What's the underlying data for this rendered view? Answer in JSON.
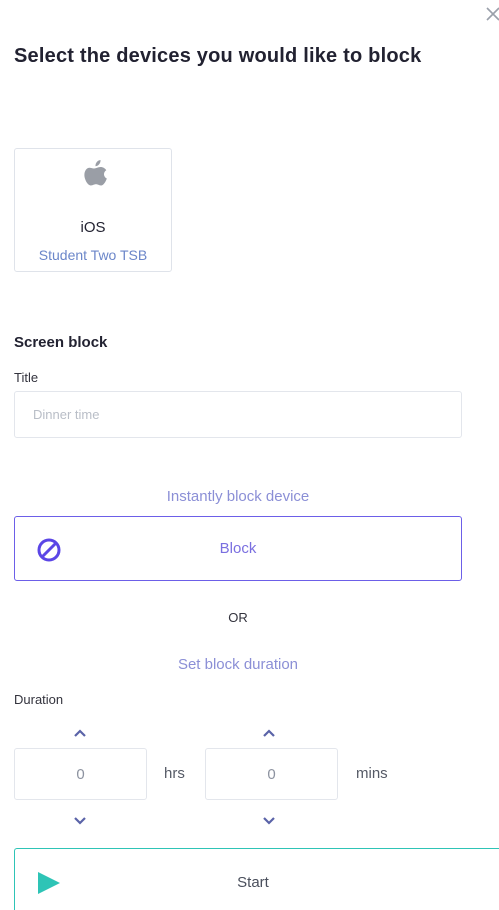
{
  "modal": {
    "close_icon": "close-icon",
    "heading": "Select the devices you would like to block"
  },
  "device": {
    "icon": "apple-icon",
    "name": "iOS",
    "owner": "Student Two TSB"
  },
  "screen_block": {
    "section_title": "Screen block",
    "title_label": "Title",
    "title_value": "",
    "title_placeholder": "Dinner time",
    "instant_label": "Instantly block device",
    "block_icon": "ban-icon",
    "block_button": "Block",
    "or_text": "OR",
    "duration_label_link": "Set block duration",
    "duration_label": "Duration",
    "hours_value": "0",
    "hours_unit": "hrs",
    "minutes_value": "0",
    "minutes_unit": "mins",
    "start_icon": "play-icon",
    "start_button": "Start"
  },
  "colors": {
    "primary_purple": "#6c5fe8",
    "link_blue": "#6b86c9",
    "teal": "#2ec4b6",
    "muted": "#8b8fd6"
  }
}
